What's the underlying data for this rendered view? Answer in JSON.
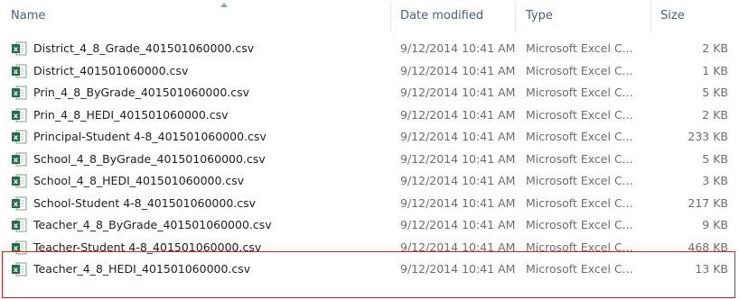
{
  "columns": {
    "name": "Name",
    "date_modified": "Date modified",
    "type": "Type",
    "size": "Size"
  },
  "files": [
    {
      "name": "District_4_8_Grade_401501060000.csv",
      "date": "9/12/2014 10:41 AM",
      "type": "Microsoft Excel C...",
      "size": "2 KB"
    },
    {
      "name": "District_401501060000.csv",
      "date": "9/12/2014 10:41 AM",
      "type": "Microsoft Excel C...",
      "size": "1 KB"
    },
    {
      "name": "Prin_4_8_ByGrade_401501060000.csv",
      "date": "9/12/2014 10:41 AM",
      "type": "Microsoft Excel C...",
      "size": "5 KB"
    },
    {
      "name": "Prin_4_8_HEDI_401501060000.csv",
      "date": "9/12/2014 10:41 AM",
      "type": "Microsoft Excel C...",
      "size": "2 KB"
    },
    {
      "name": "Principal-Student 4-8_401501060000.csv",
      "date": "9/12/2014 10:41 AM",
      "type": "Microsoft Excel C...",
      "size": "233 KB"
    },
    {
      "name": "School_4_8_ByGrade_401501060000.csv",
      "date": "9/12/2014 10:41 AM",
      "type": "Microsoft Excel C...",
      "size": "5 KB"
    },
    {
      "name": "School_4_8_HEDI_401501060000.csv",
      "date": "9/12/2014 10:41 AM",
      "type": "Microsoft Excel C...",
      "size": "3 KB"
    },
    {
      "name": "School-Student 4-8_401501060000.csv",
      "date": "9/12/2014 10:41 AM",
      "type": "Microsoft Excel C...",
      "size": "217 KB"
    },
    {
      "name": "Teacher_4_8_ByGrade_401501060000.csv",
      "date": "9/12/2014 10:41 AM",
      "type": "Microsoft Excel C...",
      "size": "9 KB"
    },
    {
      "name": "Teacher-Student 4-8_401501060000.csv",
      "date": "9/12/2014 10:41 AM",
      "type": "Microsoft Excel C...",
      "size": "468 KB"
    },
    {
      "name": "Teacher_4_8_HEDI_401501060000.csv",
      "date": "9/12/2014 10:41 AM",
      "type": "Microsoft Excel C...",
      "size": "13 KB"
    }
  ],
  "icon": "excel-csv-file-icon",
  "colors": {
    "header_text": "#4c607a",
    "highlight": "#e02020",
    "excel_green": "#1e7145"
  }
}
